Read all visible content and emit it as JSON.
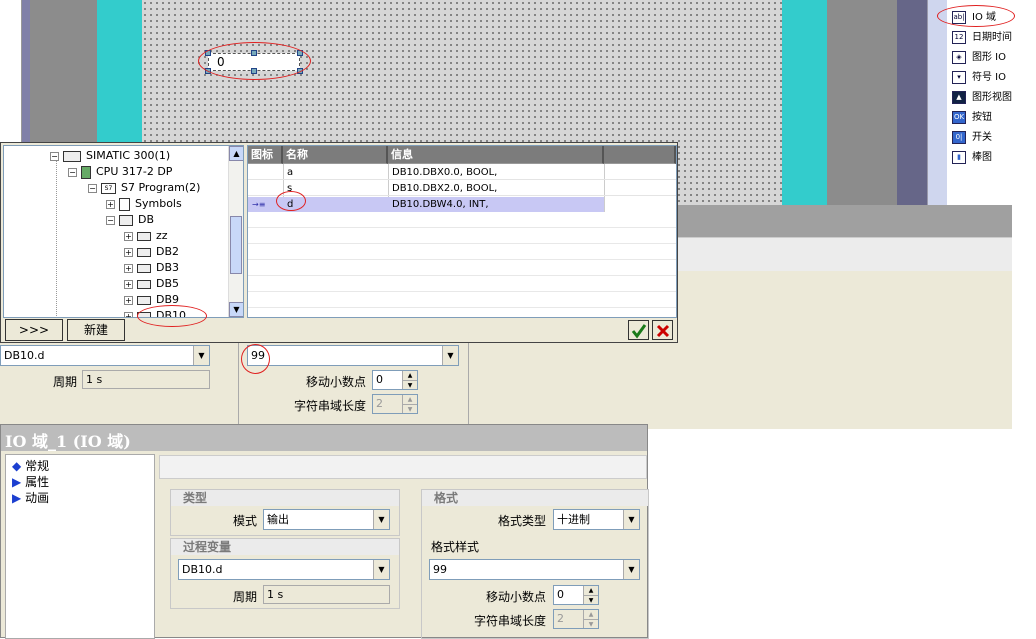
{
  "canvas": {
    "io_field_value": "0"
  },
  "toolbox": {
    "items": [
      {
        "label": "IO 域",
        "icon": "io-field-icon",
        "glyph": "ab|"
      },
      {
        "label": "日期时间",
        "icon": "datetime-icon",
        "glyph": "12"
      },
      {
        "label": "图形 IO",
        "icon": "graphic-io-icon",
        "glyph": "◈"
      },
      {
        "label": "符号 IO",
        "icon": "symbolic-io-icon",
        "glyph": "▾"
      },
      {
        "label": "图形视图",
        "icon": "graphic-view-icon",
        "glyph": "▲"
      },
      {
        "label": "按钮",
        "icon": "button-icon",
        "glyph": "OK"
      },
      {
        "label": "开关",
        "icon": "switch-icon",
        "glyph": "0|"
      },
      {
        "label": "棒图",
        "icon": "bar-icon",
        "glyph": "▮"
      }
    ]
  },
  "tag_dialog": {
    "tree": [
      {
        "label": "SIMATIC 300(1)",
        "icon": "simatic-station-icon"
      },
      {
        "label": "CPU 317-2 DP",
        "icon": "cpu-icon"
      },
      {
        "label": "S7 Program(2)",
        "icon": "s7-program-icon",
        "glyph": "S7"
      },
      {
        "label": "Symbols",
        "icon": "symbols-icon"
      },
      {
        "label": "DB",
        "icon": "db-folder-icon"
      },
      {
        "label": "zz",
        "icon": "block-icon"
      },
      {
        "label": "DB2",
        "icon": "block-icon"
      },
      {
        "label": "DB3",
        "icon": "block-icon"
      },
      {
        "label": "DB5",
        "icon": "block-icon"
      },
      {
        "label": "DB9",
        "icon": "block-icon"
      },
      {
        "label": "DB10",
        "icon": "block-icon"
      }
    ],
    "columns": [
      "图标",
      "名称",
      "信息",
      ""
    ],
    "rows": [
      {
        "icon": "",
        "name": "a",
        "info": "DB10.DBX0.0, BOOL,"
      },
      {
        "icon": "",
        "name": "s",
        "info": "DB10.DBX2.0, BOOL,"
      },
      {
        "icon": "→≡",
        "name": "d",
        "info": "DB10.DBW4.0, INT,"
      }
    ],
    "expand_label": ">>>",
    "new_label": "新建"
  },
  "upper_props": {
    "var_value": "DB10.d",
    "period_label": "周期",
    "period_value": "1 s",
    "format_value": "99",
    "decimals_label": "移动小数点",
    "decimals_value": "0",
    "strlen_label": "字符串域长度",
    "strlen_value": "2"
  },
  "props_window": {
    "title": "IO 域_1 (IO 域)",
    "nav": [
      "常规",
      "属性",
      "动画"
    ],
    "type_group": "类型",
    "mode_label": "模式",
    "mode_value": "输出",
    "pv_group": "过程变量",
    "pv_value": "DB10.d",
    "period_label": "周期",
    "period_value": "1 s",
    "format_group": "格式",
    "format_type_label": "格式类型",
    "format_type_value": "十进制",
    "format_style_label": "格式样式",
    "format_style_value": "99",
    "decimals_label": "移动小数点",
    "decimals_value": "0",
    "strlen_label": "字符串域长度",
    "strlen_value": "2"
  }
}
